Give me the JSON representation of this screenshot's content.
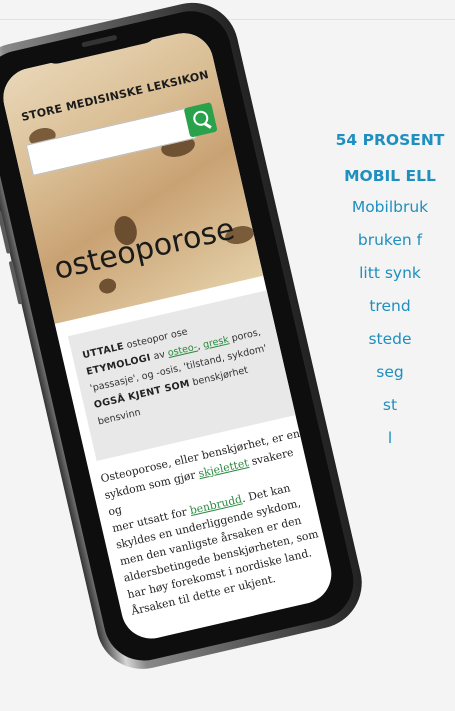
{
  "page": {
    "side_text": {
      "heading1": "54 PROSENT",
      "heading2": "MOBIL ELL",
      "lines": [
        "Mobilbruk",
        "bruken f",
        "litt synk",
        "trend",
        "stede",
        "seg",
        "st",
        "l"
      ]
    }
  },
  "phone": {
    "site_name": "STORE MEDISINSKE LEKSIKON",
    "search": {
      "placeholder": "",
      "icon": "search-icon"
    },
    "headword": "osteoporose",
    "info": {
      "uttale_label": "UTTALE",
      "uttale_value": "osteopor ose",
      "etymologi_label": "ETYMOLOGI",
      "etymologi_prefix": "av",
      "etymologi_link1": "osteo-",
      "etymologi_comma": ",",
      "etymologi_link2": "gresk",
      "etymologi_rest1": "poros,",
      "etymologi_rest2": "'passasje', og -osis, 'tilstand, sykdom'",
      "kjent_label": "OGSÅ KJENT SOM",
      "kjent_value1": "benskjørhet",
      "kjent_value2": "bensvinn"
    },
    "body": {
      "l1": "Osteoporose, eller benskjørhet, er en",
      "l2_pre": "sykdom som gjør",
      "l2_link": "skjelettet",
      "l2_post": "svakere og",
      "l3_pre": "mer utsatt for",
      "l3_link": "benbrudd",
      "l3_post": ". Det kan",
      "l4": "skyldes en underliggende sykdom,",
      "l5": "men den vanligste årsaken er den",
      "l6": "aldersbetingede benskjørheten, som",
      "l7": "har høy forekomst i nordiske land.",
      "l8": "Årsaken til dette er ukjent."
    },
    "colors": {
      "accent_green": "#2aa24c",
      "link_green": "#2a8a3e",
      "side_blue": "#1e8fbf"
    }
  }
}
